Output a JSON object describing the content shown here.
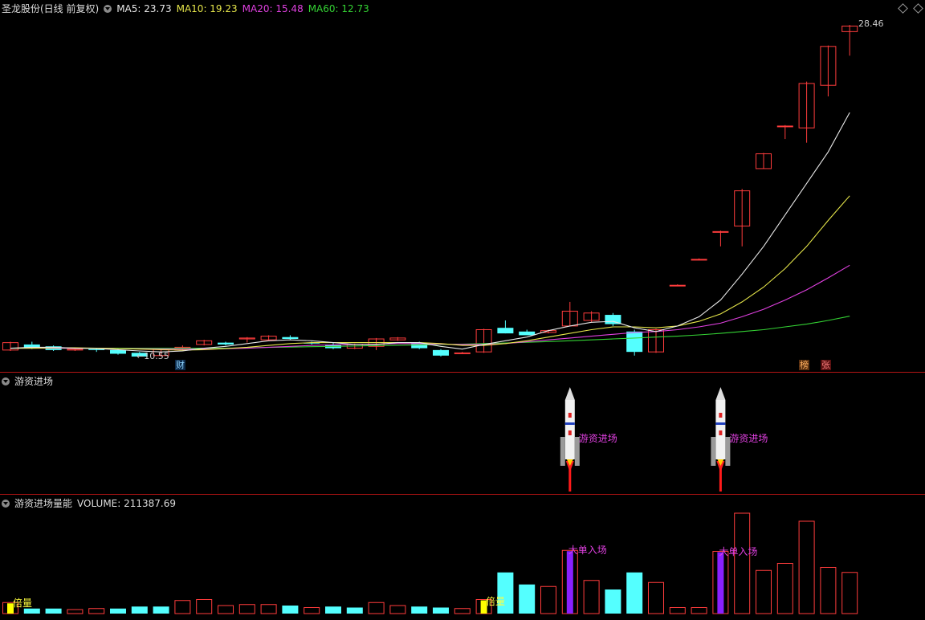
{
  "main": {
    "stock_title": "圣龙股份(日线 前复权)",
    "ma5": "MA5: 23.73",
    "ma10": "MA10: 19.23",
    "ma20": "MA20: 15.48",
    "ma60": "MA60: 12.73",
    "high_label": "28.46",
    "low_label": "←10.55",
    "tag_cai": "财",
    "tag_bang": "榜",
    "tag_zhang": "张",
    "colors": {
      "up": "#ff3c3c",
      "down": "#54ffff",
      "ma5": "#e8e8e8",
      "ma10": "#e6e64a",
      "ma20": "#e040e0",
      "ma60": "#34d334"
    },
    "candles": [
      {
        "o": 10.9,
        "c": 11.3,
        "h": 11.35,
        "l": 10.85
      },
      {
        "o": 11.2,
        "c": 11.0,
        "h": 11.35,
        "l": 10.95
      },
      {
        "o": 11.1,
        "c": 10.9,
        "h": 11.15,
        "l": 10.85
      },
      {
        "o": 10.9,
        "c": 10.95,
        "h": 11.0,
        "l": 10.85
      },
      {
        "o": 10.95,
        "c": 10.9,
        "h": 11.0,
        "l": 10.8
      },
      {
        "o": 10.9,
        "c": 10.7,
        "h": 10.95,
        "l": 10.65
      },
      {
        "o": 10.75,
        "c": 10.55,
        "h": 10.8,
        "l": 10.55
      },
      {
        "o": 10.6,
        "c": 10.95,
        "h": 11.0,
        "l": 10.55
      },
      {
        "o": 10.9,
        "c": 11.05,
        "h": 11.15,
        "l": 10.9
      },
      {
        "o": 11.2,
        "c": 11.4,
        "h": 11.45,
        "l": 11.15
      },
      {
        "o": 11.3,
        "c": 11.2,
        "h": 11.35,
        "l": 11.15
      },
      {
        "o": 11.5,
        "c": 11.55,
        "h": 11.6,
        "l": 11.3
      },
      {
        "o": 11.45,
        "c": 11.65,
        "h": 11.7,
        "l": 11.4
      },
      {
        "o": 11.6,
        "c": 11.5,
        "h": 11.7,
        "l": 11.45
      },
      {
        "o": 11.3,
        "c": 11.25,
        "h": 11.35,
        "l": 11.2
      },
      {
        "o": 11.2,
        "c": 11.0,
        "h": 11.3,
        "l": 10.95
      },
      {
        "o": 11.0,
        "c": 11.2,
        "h": 11.25,
        "l": 10.95
      },
      {
        "o": 11.1,
        "c": 11.5,
        "h": 11.55,
        "l": 10.9
      },
      {
        "o": 11.45,
        "c": 11.55,
        "h": 11.6,
        "l": 11.4
      },
      {
        "o": 11.3,
        "c": 11.0,
        "h": 11.35,
        "l": 10.95
      },
      {
        "o": 10.9,
        "c": 10.6,
        "h": 10.95,
        "l": 10.55
      },
      {
        "o": 10.7,
        "c": 10.75,
        "h": 10.8,
        "l": 10.7
      },
      {
        "o": 10.8,
        "c": 12.0,
        "h": 12.05,
        "l": 10.75
      },
      {
        "o": 12.1,
        "c": 11.8,
        "h": 12.5,
        "l": 11.8
      },
      {
        "o": 11.9,
        "c": 11.7,
        "h": 12.0,
        "l": 11.7
      },
      {
        "o": 11.85,
        "c": 11.95,
        "h": 12.0,
        "l": 11.8
      },
      {
        "o": 12.2,
        "c": 13.0,
        "h": 13.5,
        "l": 12.2
      },
      {
        "o": 12.5,
        "c": 12.9,
        "h": 13.0,
        "l": 12.4
      },
      {
        "o": 12.8,
        "c": 12.3,
        "h": 12.9,
        "l": 12.2
      },
      {
        "o": 11.9,
        "c": 10.8,
        "h": 12.0,
        "l": 10.6
      },
      {
        "o": 10.8,
        "c": 12.0,
        "h": 12.05,
        "l": 10.75
      },
      {
        "o": 14.4,
        "c": 14.4,
        "h": 14.45,
        "l": 14.35
      },
      {
        "o": 15.8,
        "c": 15.8,
        "h": 15.85,
        "l": 15.75
      },
      {
        "o": 17.3,
        "c": 17.3,
        "h": 17.35,
        "l": 16.5
      },
      {
        "o": 17.6,
        "c": 19.5,
        "h": 19.6,
        "l": 16.5
      },
      {
        "o": 20.7,
        "c": 21.5,
        "h": 21.55,
        "l": 20.7
      },
      {
        "o": 23.0,
        "c": 23.0,
        "h": 23.05,
        "l": 22.3
      },
      {
        "o": 22.9,
        "c": 25.3,
        "h": 25.4,
        "l": 22.1
      },
      {
        "o": 25.2,
        "c": 27.3,
        "h": 27.35,
        "l": 24.6
      },
      {
        "o": 28.1,
        "c": 28.4,
        "h": 28.46,
        "l": 26.8
      }
    ],
    "ma5_line": [
      11.0,
      11.05,
      11.05,
      11.0,
      10.98,
      10.92,
      10.85,
      10.8,
      10.85,
      11.0,
      11.1,
      11.25,
      11.4,
      11.45,
      11.4,
      11.3,
      11.2,
      11.2,
      11.3,
      11.3,
      11.1,
      10.95,
      11.2,
      11.4,
      11.6,
      11.95,
      12.2,
      12.4,
      12.45,
      12.1,
      11.9,
      12.2,
      12.7,
      13.6,
      15.0,
      16.5,
      18.2,
      19.9,
      21.6,
      23.73
    ],
    "ma10_line": [
      11.0,
      11.0,
      11.02,
      11.02,
      11.0,
      10.98,
      10.95,
      10.92,
      10.9,
      10.92,
      10.98,
      11.05,
      11.15,
      11.25,
      11.3,
      11.3,
      11.3,
      11.3,
      11.3,
      11.3,
      11.25,
      11.15,
      11.15,
      11.25,
      11.4,
      11.6,
      11.8,
      12.0,
      12.15,
      12.15,
      12.1,
      12.2,
      12.45,
      12.85,
      13.5,
      14.3,
      15.3,
      16.5,
      17.9,
      19.23
    ],
    "ma20_line": [
      11.0,
      11.0,
      11.0,
      11.0,
      11.0,
      10.98,
      10.97,
      10.96,
      10.95,
      10.95,
      10.97,
      11.0,
      11.05,
      11.1,
      11.15,
      11.18,
      11.2,
      11.22,
      11.25,
      11.25,
      11.22,
      11.2,
      11.2,
      11.25,
      11.35,
      11.45,
      11.55,
      11.65,
      11.75,
      11.85,
      11.9,
      12.0,
      12.15,
      12.35,
      12.7,
      13.1,
      13.6,
      14.15,
      14.8,
      15.48
    ],
    "ma60_line": [
      11.0,
      11.0,
      11.0,
      11.0,
      11.0,
      11.0,
      11.0,
      11.0,
      11.0,
      11.0,
      11.0,
      11.02,
      11.04,
      11.06,
      11.08,
      11.1,
      11.12,
      11.14,
      11.16,
      11.18,
      11.2,
      11.22,
      11.25,
      11.28,
      11.32,
      11.36,
      11.4,
      11.45,
      11.5,
      11.55,
      11.6,
      11.65,
      11.72,
      11.8,
      11.9,
      12.0,
      12.15,
      12.3,
      12.5,
      12.73
    ],
    "price_range": [
      10.2,
      29.2
    ]
  },
  "signal": {
    "title": "游资进场",
    "rocket_label_1": "游资进场",
    "rocket_label_2": "游资进场",
    "rocket_bars": [
      26,
      33
    ]
  },
  "volume": {
    "title": "游资进场量能",
    "volume_value": "VOLUME: 211387.69",
    "label_beiliang_1": "倍量",
    "label_beiliang_2": "倍量",
    "label_dadan_1": "大单入场",
    "label_dadan_2": "大单入场",
    "bars": [
      {
        "v": 0.11,
        "t": "yellow"
      },
      {
        "v": 0.05,
        "t": "down"
      },
      {
        "v": 0.05,
        "t": "down"
      },
      {
        "v": 0.04,
        "t": "up"
      },
      {
        "v": 0.05,
        "t": "up"
      },
      {
        "v": 0.05,
        "t": "down"
      },
      {
        "v": 0.07,
        "t": "down"
      },
      {
        "v": 0.07,
        "t": "down"
      },
      {
        "v": 0.13,
        "t": "up"
      },
      {
        "v": 0.14,
        "t": "up"
      },
      {
        "v": 0.08,
        "t": "up"
      },
      {
        "v": 0.09,
        "t": "up"
      },
      {
        "v": 0.09,
        "t": "up"
      },
      {
        "v": 0.08,
        "t": "down"
      },
      {
        "v": 0.06,
        "t": "up"
      },
      {
        "v": 0.07,
        "t": "down"
      },
      {
        "v": 0.06,
        "t": "down"
      },
      {
        "v": 0.11,
        "t": "up"
      },
      {
        "v": 0.08,
        "t": "up"
      },
      {
        "v": 0.07,
        "t": "down"
      },
      {
        "v": 0.06,
        "t": "down"
      },
      {
        "v": 0.05,
        "t": "up"
      },
      {
        "v": 0.14,
        "t": "yellow"
      },
      {
        "v": 0.41,
        "t": "down"
      },
      {
        "v": 0.29,
        "t": "down"
      },
      {
        "v": 0.27,
        "t": "up"
      },
      {
        "v": 0.63,
        "t": "purple"
      },
      {
        "v": 0.33,
        "t": "up"
      },
      {
        "v": 0.24,
        "t": "down"
      },
      {
        "v": 0.41,
        "t": "down"
      },
      {
        "v": 0.31,
        "t": "up"
      },
      {
        "v": 0.06,
        "t": "up"
      },
      {
        "v": 0.06,
        "t": "up"
      },
      {
        "v": 0.62,
        "t": "purple"
      },
      {
        "v": 1.0,
        "t": "up"
      },
      {
        "v": 0.43,
        "t": "up"
      },
      {
        "v": 0.5,
        "t": "up"
      },
      {
        "v": 0.92,
        "t": "up"
      },
      {
        "v": 0.46,
        "t": "up"
      },
      {
        "v": 0.41,
        "t": "up"
      }
    ]
  }
}
